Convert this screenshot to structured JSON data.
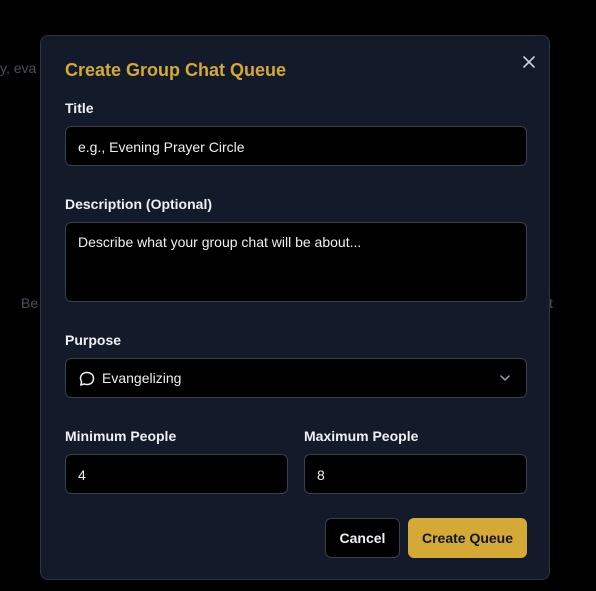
{
  "background": {
    "fragment_1": "y, eva",
    "fragment_2": "Be",
    "fragment_3": "t"
  },
  "modal": {
    "title": "Create Group Chat Queue",
    "close_icon": "close-icon",
    "title_field": {
      "label": "Title",
      "placeholder": "e.g., Evening Prayer Circle"
    },
    "description_field": {
      "label": "Description (Optional)",
      "placeholder": "Describe what your group chat will be about..."
    },
    "purpose_field": {
      "label": "Purpose",
      "icon": "chat-bubble-icon",
      "selected": "Evangelizing"
    },
    "min_people": {
      "label": "Minimum People",
      "value": "4"
    },
    "max_people": {
      "label": "Maximum People",
      "value": "8"
    },
    "buttons": {
      "cancel": "Cancel",
      "create": "Create Queue"
    }
  },
  "colors": {
    "accent": "#d4a935",
    "modal_bg": "#131a2a",
    "field_bg": "#000000",
    "border": "#3a404b",
    "text": "#eef0f3"
  }
}
